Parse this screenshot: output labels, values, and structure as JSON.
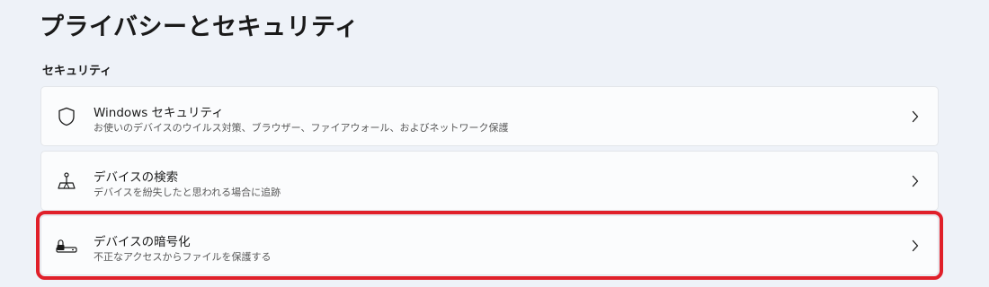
{
  "page": {
    "title": "プライバシーとセキュリティ"
  },
  "section": {
    "header": "セキュリティ"
  },
  "items": [
    {
      "icon": "shield-icon",
      "title": "Windows セキュリティ",
      "description": "お使いのデバイスのウイルス対策、ブラウザー、ファイアウォール、およびネットワーク保護"
    },
    {
      "icon": "find-device-icon",
      "title": "デバイスの検索",
      "description": "デバイスを紛失したと思われる場合に追跡"
    },
    {
      "icon": "device-encryption-icon",
      "title": "デバイスの暗号化",
      "description": "不正なアクセスからファイルを保護する"
    }
  ],
  "colors": {
    "background": "#eef2f8",
    "card": "#fbfcfd",
    "highlight": "#e0202a"
  }
}
